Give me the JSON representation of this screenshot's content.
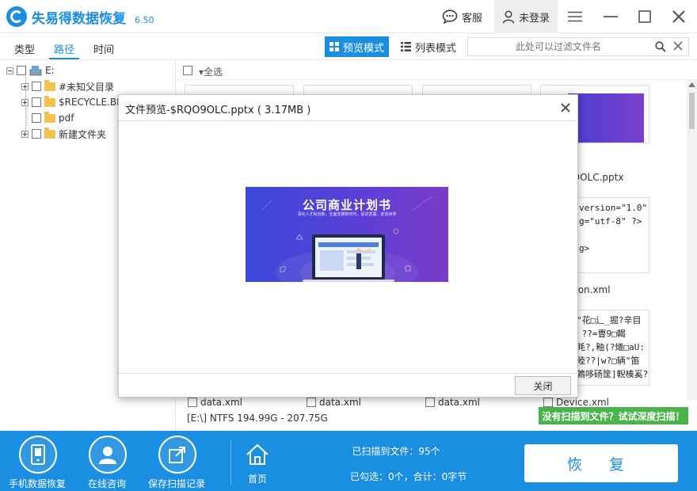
{
  "app": {
    "title": "失易得数据恢复",
    "version": "6.50"
  },
  "header": {
    "support_label": "客服",
    "user_label": "未登录"
  },
  "tabs": {
    "type_label": "类型",
    "path_label": "路径",
    "time_label": "时间"
  },
  "view_modes": {
    "preview_label": "预览模式",
    "list_label": "列表模式"
  },
  "filter": {
    "placeholder": "此处可以过滤文件名"
  },
  "tree": {
    "root_label": "E:",
    "items": [
      {
        "label": "#未知父目录"
      },
      {
        "label": "$RECYCLE.BI"
      },
      {
        "label": "pdf"
      },
      {
        "label": "新建文件夹"
      }
    ]
  },
  "content": {
    "select_all_label": "全选",
    "file_names": [
      "O9OLC.pptx",
      "mon.xml"
    ],
    "bottom_file_names": [
      "data.xml",
      "data.xml",
      "data.xml",
      "Device.xml"
    ],
    "xml_snippet": "version=\"1.0\"\ng=\"utf-8\" ?>\n\ng>",
    "garbled_snippet": "\"花□辶_掘?辛目\n ??=曺9□輵\n眊?,釉(?爔□aU:\n睦??|w?□辆\"笛\n鶉哆砀筐]輗楱奚?"
  },
  "status": {
    "disk_info": "[E:\\] NTFS 194.99G - 207.75G",
    "deep_scan_label": "没有扫描到文件？试试深度扫描！"
  },
  "bottom": {
    "mobile_label": "手机数据恢复",
    "consult_label": "在线咨询",
    "save_label": "保存扫描记录",
    "home_label": "首页",
    "scan_count_text": "已扫描到文件：95个",
    "checked_text": "已勾选：0个，合计：0字节",
    "recover_label": "恢 复"
  },
  "modal": {
    "title": "文件预览-$RQO9OLC.pptx ( 3.17MB )",
    "close_label": "关闭",
    "slide_title": "公司商业计划书",
    "slide_subtitle": "深化人才和创新，全面支撑新时代，促进发展，走向世界"
  },
  "colors": {
    "accent": "#1a8ee1",
    "green": "#4bb34b",
    "slide_start": "#3a48d8",
    "slide_end": "#7a3cc8"
  }
}
